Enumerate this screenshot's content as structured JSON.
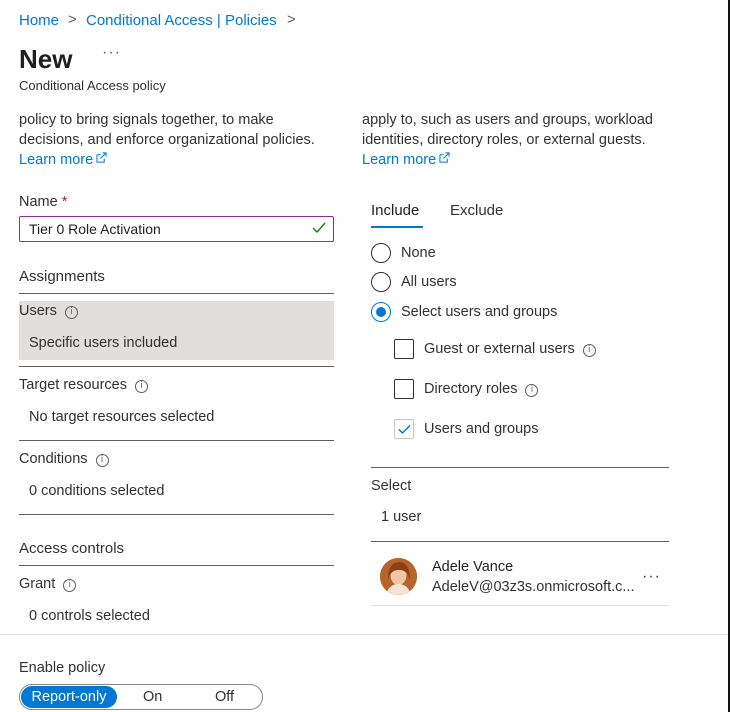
{
  "breadcrumb": {
    "home": "Home",
    "policies": "Conditional Access | Policies",
    "separator": ">"
  },
  "page": {
    "title": "New",
    "more": "···",
    "subtitle": "Conditional Access policy"
  },
  "left_intro": {
    "line1": "policy to bring signals together, to make",
    "line2": "decisions, and enforce organizational policies.",
    "learn_more": "Learn more"
  },
  "right_intro": {
    "line1": "apply to, such as users and groups, workload",
    "line2": "identities, directory roles, or external guests.",
    "learn_more": "Learn more"
  },
  "name": {
    "label": "Name",
    "required": "*",
    "value": "Tier 0 Role Activation"
  },
  "assignments": {
    "heading": "Assignments",
    "users": {
      "label": "Users",
      "value": "Specific users included"
    },
    "target": {
      "label": "Target resources",
      "value": "No target resources selected"
    },
    "conditions": {
      "label": "Conditions",
      "value": "0 conditions selected"
    }
  },
  "access_controls": {
    "heading": "Access controls",
    "grant": {
      "label": "Grant",
      "value": "0 controls selected"
    }
  },
  "tabs": {
    "include": "Include",
    "exclude": "Exclude"
  },
  "include_options": {
    "none": "None",
    "all_users": "All users",
    "select_users": "Select users and groups",
    "selected": "select_users"
  },
  "checkboxes": {
    "guest": {
      "label": "Guest or external users",
      "checked": false
    },
    "directory_roles": {
      "label": "Directory roles",
      "checked": false
    },
    "users_groups": {
      "label": "Users and groups",
      "checked": true
    }
  },
  "select": {
    "label": "Select",
    "count": "1 user"
  },
  "selected_user": {
    "name": "Adele Vance",
    "email": "AdeleV@03z3s.onmicrosoft.c...",
    "more": "···"
  },
  "enable_policy": {
    "label": "Enable policy",
    "options": [
      "Report-only",
      "On",
      "Off"
    ],
    "selected": "Report-only"
  },
  "colors": {
    "accent": "#0078d4",
    "input_border": "#8a2da5",
    "required": "#a4262c",
    "check": "#107c10"
  }
}
